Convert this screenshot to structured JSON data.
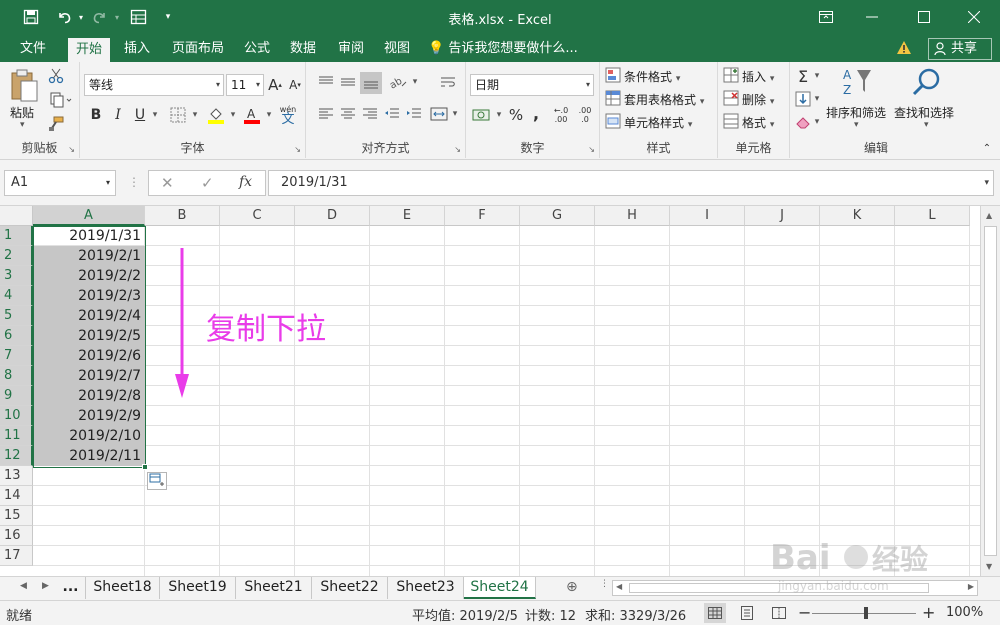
{
  "titlebar": {
    "title": "表格.xlsx - Excel",
    "icons": [
      "save-icon",
      "undo-icon",
      "redo-icon",
      "form-icon",
      "customize-icon"
    ],
    "window_icons": [
      "ribbon-display-icon",
      "minimize-icon",
      "maximize-icon",
      "close-icon"
    ]
  },
  "tabs": {
    "items": [
      "文件",
      "开始",
      "插入",
      "页面布局",
      "公式",
      "数据",
      "审阅",
      "视图"
    ],
    "active": "开始",
    "tell_me": "告诉我您想要做什么...",
    "share": "共享"
  },
  "ribbon": {
    "clipboard": {
      "label": "剪贴板",
      "paste": "粘贴"
    },
    "font": {
      "label": "字体",
      "font_name": "等线",
      "font_size": "11",
      "bold": "B",
      "italic": "I",
      "underline": "U",
      "increase": "A",
      "decrease": "A",
      "wen": "wén",
      "wen_char": "文"
    },
    "alignment": {
      "label": "对齐方式"
    },
    "number": {
      "label": "数字",
      "format": "日期",
      "percent": "%",
      "comma": ",",
      "inc_decimal": ".00",
      "dec_decimal": ".0"
    },
    "styles": {
      "label": "样式",
      "conditional": "条件格式",
      "table": "套用表格格式",
      "cell_styles": "单元格样式"
    },
    "cells": {
      "label": "单元格",
      "insert": "插入",
      "delete": "删除",
      "format": "格式"
    },
    "editing": {
      "label": "编辑",
      "sigma": "Σ",
      "sort": "排序和筛选",
      "find": "查找和选择",
      "az": "A Z"
    }
  },
  "formula_bar": {
    "name_box": "A1",
    "cancel": "✕",
    "enter": "✓",
    "fx": "fx",
    "content": "2019/1/31"
  },
  "grid": {
    "columns": [
      "A",
      "B",
      "C",
      "D",
      "E",
      "F",
      "G",
      "H",
      "I",
      "J",
      "K",
      "L"
    ],
    "rows": [
      "1",
      "2",
      "3",
      "4",
      "5",
      "6",
      "7",
      "8",
      "9",
      "10",
      "11",
      "12",
      "13",
      "14",
      "15",
      "16",
      "17"
    ],
    "cells_a": [
      "2019/1/31",
      "2019/2/1",
      "2019/2/2",
      "2019/2/3",
      "2019/2/4",
      "2019/2/5",
      "2019/2/6",
      "2019/2/7",
      "2019/2/8",
      "2019/2/9",
      "2019/2/10",
      "2019/2/11"
    ],
    "annotation": "复制下拉",
    "annotation_color": "#e93ce9"
  },
  "sheets": {
    "items": [
      "Sheet18",
      "Sheet19",
      "Sheet21",
      "Sheet22",
      "Sheet23",
      "Sheet24"
    ],
    "active": "Sheet24",
    "more": "..."
  },
  "status": {
    "ready": "就绪",
    "average": "平均值: 2019/2/5",
    "count": "计数: 12",
    "sum": "求和: 3329/3/26",
    "zoom": "100%",
    "minus": "−",
    "plus": "+"
  },
  "watermark": {
    "brand": "Bai 经验",
    "url": "jingyan.baidu.com"
  },
  "colors": {
    "accent": "#217346",
    "selection": "#c6c6c6"
  }
}
